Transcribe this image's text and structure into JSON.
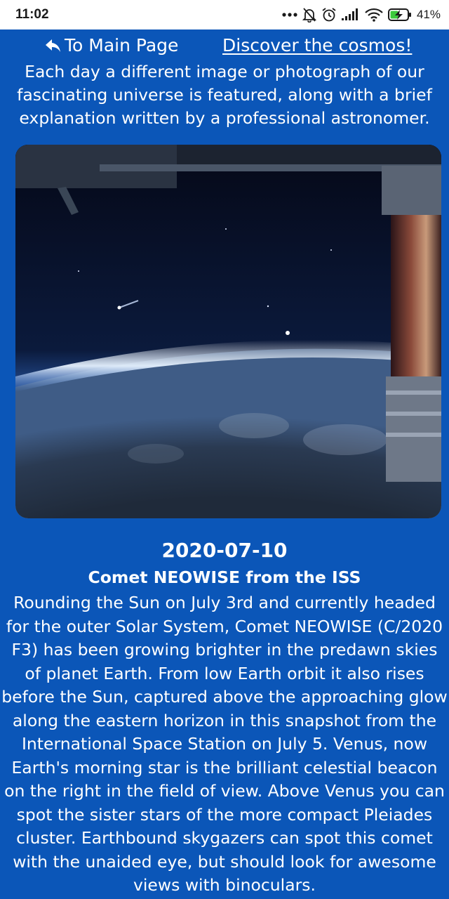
{
  "status_bar": {
    "time": "11:02",
    "battery": "41%",
    "icons": [
      "more-dots-icon",
      "mute-bell-icon",
      "alarm-icon",
      "signal-icon",
      "wifi-icon",
      "battery-charging-icon"
    ]
  },
  "nav": {
    "back_label": "To Main Page",
    "back_icon": "reply-arrow-icon",
    "discover_label": "Discover the cosmos!"
  },
  "intro": "Each day a different image or photograph of our fascinating universe is featured, along with a brief explanation written by a professional astronomer.",
  "apod": {
    "date": "2020-07-10",
    "title": "Comet NEOWISE from the ISS",
    "explanation": "Rounding the Sun on July 3rd and currently headed for the outer Solar System, Comet NEOWISE (C/2020 F3) has been growing brighter in the predawn skies of planet Earth. From low Earth orbit it also rises before the Sun, captured above the approaching glow along the eastern horizon in this snapshot from the International Space Station on July 5. Venus, now Earth's morning star is the brilliant celestial beacon on the right in the field of view. Above Venus you can spot the sister stars of the more compact Pleiades cluster. Earthbound skygazers can spot this comet with the unaided eye, but should look for awesome views with binoculars."
  },
  "colors": {
    "background": "#0b56b8",
    "text": "#ffffff",
    "status_bar": "#ffffff",
    "battery_accent": "#3cc93c"
  }
}
